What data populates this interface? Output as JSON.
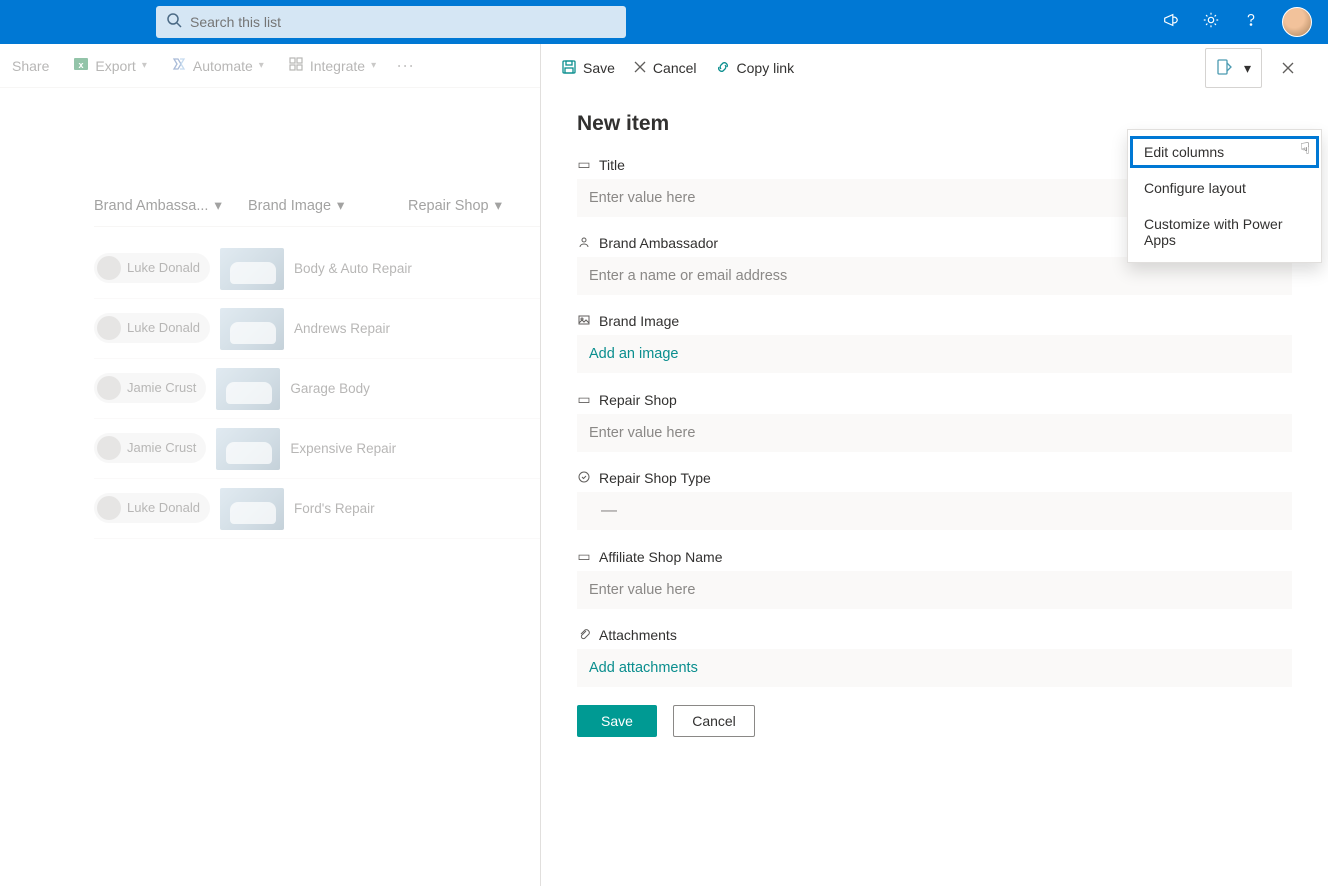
{
  "topbar": {
    "search_placeholder": "Search this list"
  },
  "cmd": {
    "share": "Share",
    "export": "Export",
    "automate": "Automate",
    "integrate": "Integrate"
  },
  "columns": {
    "ambassador": "Brand Ambassa...",
    "image": "Brand Image",
    "repair": "Repair Shop"
  },
  "rows": [
    {
      "person": "Luke Donald",
      "repair": "Body & Auto Repair"
    },
    {
      "person": "Luke Donald",
      "repair": "Andrews Repair"
    },
    {
      "person": "Jamie Crust",
      "repair": "Garage Body"
    },
    {
      "person": "Jamie Crust",
      "repair": "Expensive Repair"
    },
    {
      "person": "Luke Donald",
      "repair": "Ford's Repair"
    }
  ],
  "panel": {
    "actions": {
      "save": "Save",
      "cancel": "Cancel",
      "copy": "Copy link"
    },
    "title": "New item",
    "fields": {
      "title_label": "Title",
      "title_ph": "Enter value here",
      "ambassador_label": "Brand Ambassador",
      "ambassador_ph": "Enter a name or email address",
      "image_label": "Brand Image",
      "image_link": "Add an image",
      "repair_label": "Repair Shop",
      "repair_ph": "Enter value here",
      "type_label": "Repair Shop Type",
      "type_value": "—",
      "affiliate_label": "Affiliate Shop Name",
      "affiliate_ph": "Enter value here",
      "attach_label": "Attachments",
      "attach_link": "Add attachments"
    },
    "save_btn": "Save",
    "cancel_btn": "Cancel"
  },
  "menu": {
    "edit": "Edit columns",
    "configure": "Configure layout",
    "powerapps": "Customize with Power Apps"
  }
}
